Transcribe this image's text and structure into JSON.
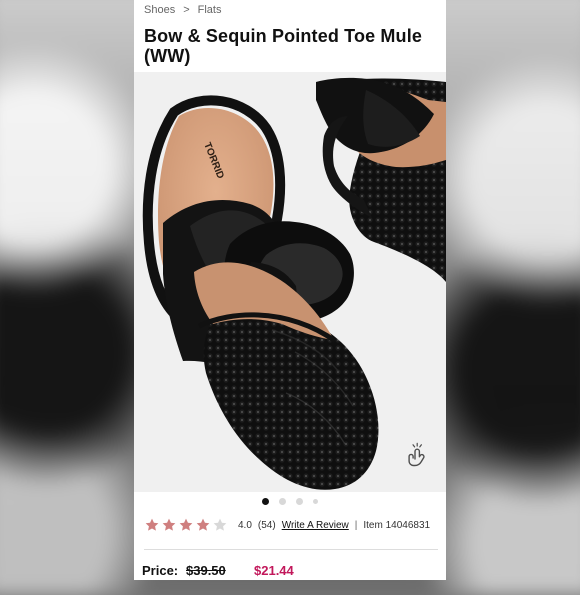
{
  "breadcrumb": {
    "items": [
      {
        "label": "Shoes"
      },
      {
        "label": "Flats"
      }
    ],
    "separator": ">"
  },
  "product": {
    "title": "Bow & Sequin Pointed Toe Mule (WW)",
    "brand_on_insole": "TORRID"
  },
  "carousel": {
    "active_index": 0,
    "count": 4
  },
  "rating": {
    "value": "4.0",
    "count_text": "(54)",
    "write_review_label": "Write A Review",
    "separator": "|",
    "item_text": "Item 14046831",
    "stars_filled": 4,
    "stars_total": 5
  },
  "pricing": {
    "label": "Price:",
    "original": "$39.50",
    "sale": "$21.44"
  },
  "icons": {
    "zoom": "tap-hand-icon",
    "star": "star-icon"
  },
  "colors": {
    "star_fill": "#cf7f7f",
    "star_empty": "#d8d8d8",
    "sale_price": "#c2185b",
    "text_dark": "#111111"
  }
}
